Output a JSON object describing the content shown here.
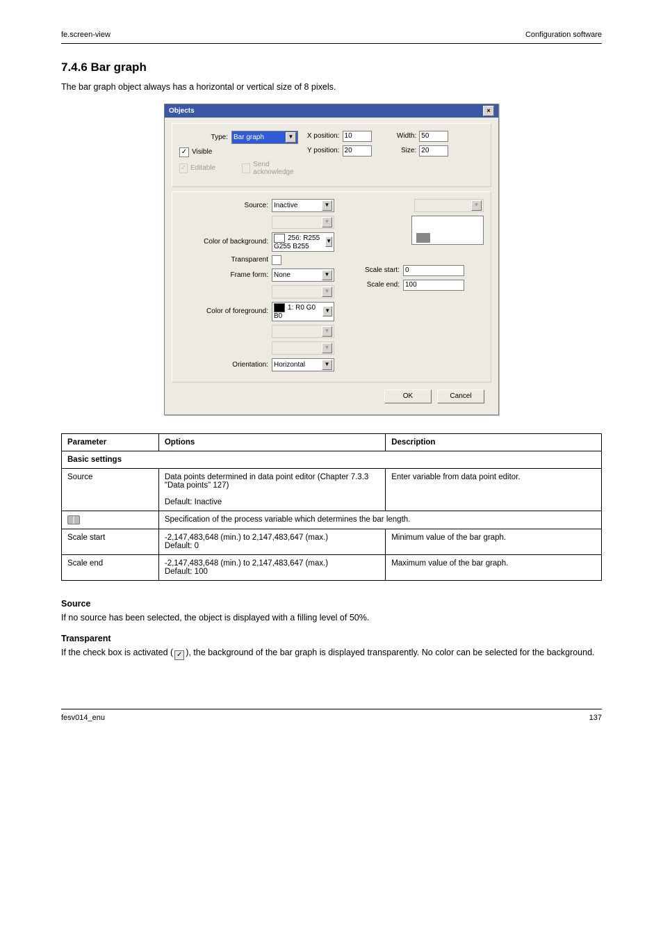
{
  "header": {
    "left": "fe.screen-view",
    "right": "Configuration software"
  },
  "section_title": "7.4.6  Bar graph",
  "intro": "The bar graph object always has a horizontal or vertical size of 8 pixels.",
  "dialog": {
    "title": "Objects",
    "type_label": "Type:",
    "type_value": "Bar graph",
    "xpos_label": "X position:",
    "xpos_value": "10",
    "width_label": "Width:",
    "width_value": "50",
    "visible_label": "Visible",
    "ypos_label": "Y position:",
    "ypos_value": "20",
    "size_label": "Size:",
    "size_value": "20",
    "editable_label": "Editable",
    "sendack_label": "Send acknowledge",
    "source_label": "Source:",
    "source_value": "Inactive",
    "bgcolor_label": "Color of background:",
    "bgcolor_value": "256: R255 G255 B255",
    "transparent_label": "Transparent",
    "frame_label": "Frame form:",
    "frame_value": "None",
    "scale_start_label": "Scale start:",
    "scale_start_value": "0",
    "scale_end_label": "Scale end:",
    "scale_end_value": "100",
    "fgcolor_label": "Color of foreground:",
    "fgcolor_value": "1: R0 G0 B0",
    "orientation_label": "Orientation:",
    "orientation_value": "Horizontal",
    "ok": "OK",
    "cancel": "Cancel"
  },
  "table": {
    "headers": [
      "Parameter",
      "Options",
      "Description"
    ],
    "basic_header": "Basic settings",
    "rows": [
      {
        "param": "Source",
        "options": "Data points determined in data point editor (Chapter 7.3.3 \"Data points\"  127)\n\nDefault: Inactive",
        "desc": "Enter variable from data point editor."
      },
      {
        "param": "",
        "book": true,
        "options": "Specification of the process variable which determines the bar length.",
        "desc": ""
      },
      {
        "param": "Scale start",
        "options": "-2,147,483,648 (min.) to 2,147,483,647 (max.)\nDefault: 0",
        "desc": "Minimum value of the bar graph."
      },
      {
        "param": "Scale end",
        "options": "-2,147,483,648 (min.) to 2,147,483,647 (max.)\nDefault: 100",
        "desc": "Maximum value of the bar graph."
      }
    ]
  },
  "body": {
    "sh1": "Source",
    "p1": "If no source has been selected, the object is displayed with a filling level of 50%.",
    "sh2": "Transparent",
    "p2_prefix": "If the check box is activated (",
    "p2_suffix": "), the background of the bar graph is displayed transparently. No color can be selected for the background."
  },
  "footer": {
    "left": "fesv014_enu",
    "right": "137"
  }
}
